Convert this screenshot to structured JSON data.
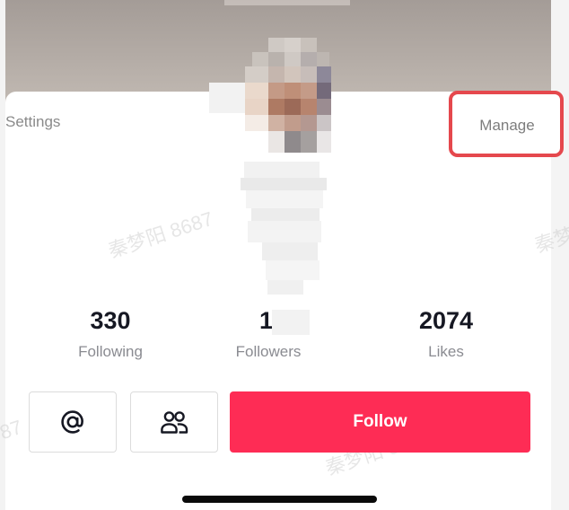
{
  "header": {
    "settings_label": "Settings",
    "manage_label": "Manage"
  },
  "profile": {
    "avatar_icon": "blurred-avatar",
    "name_redacted": true
  },
  "stats": [
    {
      "value": "330",
      "label": "Following"
    },
    {
      "value": "1",
      "label": "Followers"
    },
    {
      "value": "2074",
      "label": "Likes"
    }
  ],
  "actions": {
    "mention_icon": "at-sign-icon",
    "friends_icon": "two-people-icon",
    "follow_label": "Follow"
  },
  "colors": {
    "follow_bg": "#fe2c55",
    "highlight_border": "#e5484d",
    "stat_value": "#161823",
    "stat_label": "#8a8b91"
  }
}
